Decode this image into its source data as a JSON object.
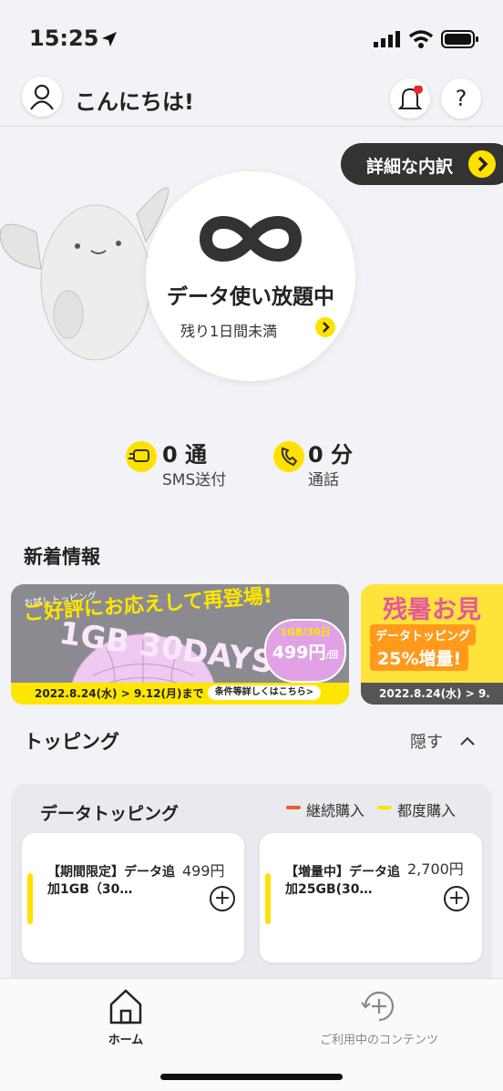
{
  "status_bar": {
    "time": "15:25"
  },
  "header": {
    "greeting": "こんにちは!",
    "help_label": "?"
  },
  "detail_button": {
    "label": "詳細な内訳"
  },
  "data_status": {
    "title": "データ使い放題中",
    "remaining": "残り1日間未満"
  },
  "usage": {
    "sms": {
      "value": "0 通",
      "label": "SMS送付"
    },
    "call": {
      "value": "0 分",
      "label": "通話"
    }
  },
  "news": {
    "title": "新着情報",
    "banner1": {
      "tag": "お試しトッピング",
      "headline": "ご好評にお応えして再登場!",
      "big_text": "1GB 30DAYS",
      "price_top": "1GB/30日",
      "price": "499円",
      "price_unit": "/回",
      "period": "2022.8.24(水) > 9.12(月)まで",
      "link": "条件等詳しくはこちら>"
    },
    "banner2": {
      "headline": "残暑お見",
      "sub1": "データトッピング",
      "sub2": "25%増量!",
      "period": "2022.8.24(水) > 9."
    }
  },
  "topping": {
    "title": "トッピング",
    "toggle_label": "隠す",
    "box_title": "データトッピング",
    "legend": {
      "continuous": "継続購入",
      "each": "都度購入",
      "continuous_color": "#e8632b",
      "each_color": "#ffe100"
    },
    "products": [
      {
        "name": "【期間限定】データ追加1GB（30…",
        "price": "499円"
      },
      {
        "name": "【増量中】データ追加25GB(30…",
        "price": "2,700円"
      }
    ]
  },
  "bottom_nav": {
    "home": "ホーム",
    "contents": "ご利用中のコンテンツ"
  },
  "colors": {
    "accent": "#ffe100",
    "dark": "#333333",
    "background": "#f2f3f6"
  }
}
